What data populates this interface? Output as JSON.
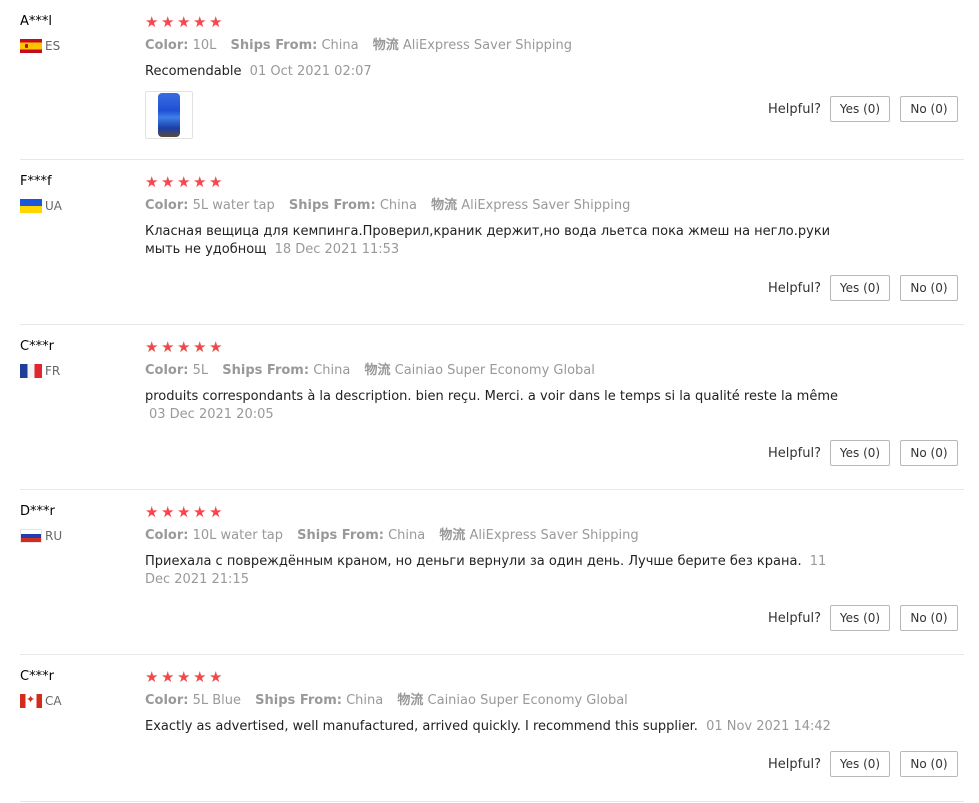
{
  "labels": {
    "color": "Color:",
    "ships_from": "Ships From:",
    "logistics": "物流",
    "helpful": "Helpful?"
  },
  "reviews": [
    {
      "user": "A***l",
      "country": "ES",
      "flag": "spain-flag",
      "rating": 5,
      "color": "10L",
      "ships_from": "China",
      "logistics": "AliExpress Saver Shipping",
      "text": "Recomendable",
      "date": "01 Oct 2021 02:07",
      "has_photo": true,
      "yes": "Yes (0)",
      "no": "No (0)"
    },
    {
      "user": "F***f",
      "country": "UA",
      "flag": "ukraine-flag",
      "rating": 5,
      "color": "5L water tap",
      "ships_from": "China",
      "logistics": "AliExpress Saver Shipping",
      "text": "Класная вещица для кемпинга.Проверил,краник держит,но вода льетса пока жмеш на негло.руки мыть не удобнощ",
      "date": "18 Dec 2021 11:53",
      "has_photo": false,
      "yes": "Yes (0)",
      "no": "No (0)"
    },
    {
      "user": "C***r",
      "country": "FR",
      "flag": "france-flag",
      "rating": 5,
      "color": "5L",
      "ships_from": "China",
      "logistics": "Cainiao Super Economy Global",
      "text": "produits correspondants à la description. bien reçu. Merci. a voir dans le temps si la qualité reste la même",
      "date": "03 Dec 2021 20:05",
      "has_photo": false,
      "yes": "Yes (0)",
      "no": "No (0)"
    },
    {
      "user": "D***r",
      "country": "RU",
      "flag": "russia-flag",
      "rating": 5,
      "color": "10L water tap",
      "ships_from": "China",
      "logistics": "AliExpress Saver Shipping",
      "text": "Приехала с повреждённым краном, но деньги вернули за один день. Лучше берите без крана.",
      "date": "11 Dec 2021 21:15",
      "has_photo": false,
      "yes": "Yes (0)",
      "no": "No (0)"
    },
    {
      "user": "C***r",
      "country": "CA",
      "flag": "canada-flag",
      "rating": 5,
      "color": "5L Blue",
      "ships_from": "China",
      "logistics": "Cainiao Super Economy Global",
      "text": "Exactly as advertised, well manufactured, arrived quickly. I recommend this supplier.",
      "date": "01 Nov 2021 14:42",
      "has_photo": false,
      "yes": "Yes (0)",
      "no": "No (0)"
    }
  ]
}
